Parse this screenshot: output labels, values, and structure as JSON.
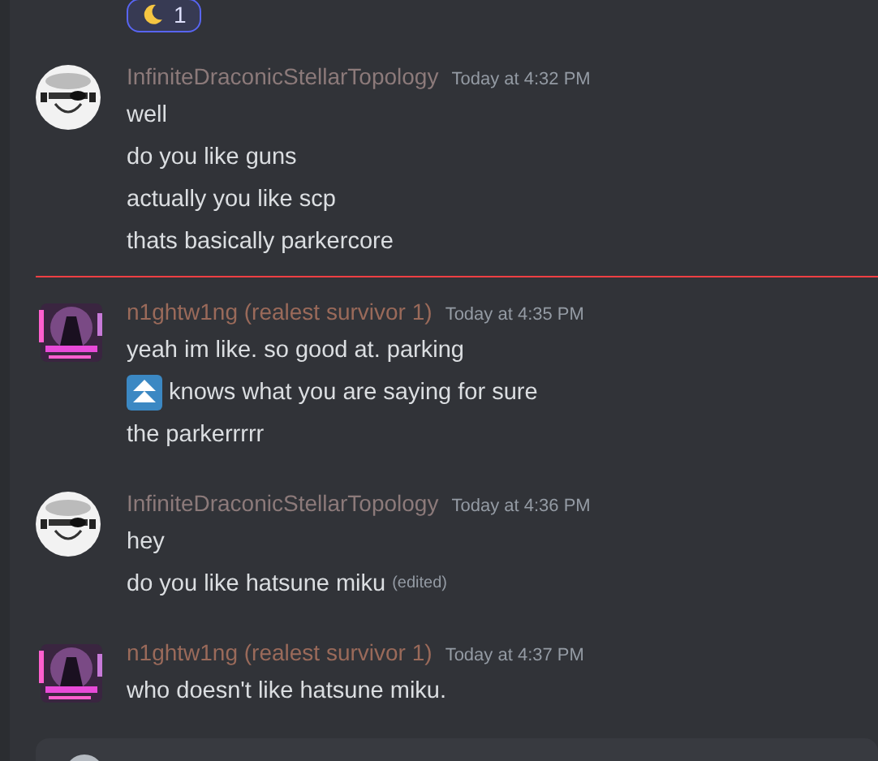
{
  "reaction": {
    "count": "1",
    "selected": true
  },
  "messages": [
    {
      "author": "InfiniteDraconicStellarTopology",
      "color": "#8c7a7a",
      "time": "Today at 4:32 PM",
      "kind": "sketch",
      "new_divider": false,
      "lines": [
        {
          "kind": "text",
          "text": "well"
        },
        {
          "kind": "text",
          "text": "do you like guns"
        },
        {
          "kind": "text",
          "text": "actually you like scp"
        },
        {
          "kind": "text",
          "text": "thats basically parkercore"
        }
      ]
    },
    {
      "author": "n1ghtw1ng (realest survivor 1)",
      "color": "#9a6a5a",
      "time": "Today at 4:35 PM",
      "kind": "neon",
      "new_divider": true,
      "lines": [
        {
          "kind": "text",
          "text": "yeah im like. so good at. parking"
        },
        {
          "kind": "emoji",
          "text": "knows what you are saying for sure"
        },
        {
          "kind": "text",
          "text": "the parkerrrrr"
        }
      ]
    },
    {
      "author": "InfiniteDraconicStellarTopology",
      "color": "#8c7a7a",
      "time": "Today at 4:36 PM",
      "kind": "sketch",
      "new_divider": false,
      "lines": [
        {
          "kind": "text",
          "text": "hey"
        },
        {
          "kind": "text",
          "text": "do you like hatsune miku",
          "edited": "(edited)"
        }
      ]
    },
    {
      "author": "n1ghtw1ng (realest survivor 1)",
      "color": "#9a6a5a",
      "time": "Today at 4:37 PM",
      "kind": "neon",
      "new_divider": false,
      "lines": [
        {
          "kind": "text",
          "text": "who doesn't like hatsune miku."
        }
      ]
    }
  ]
}
